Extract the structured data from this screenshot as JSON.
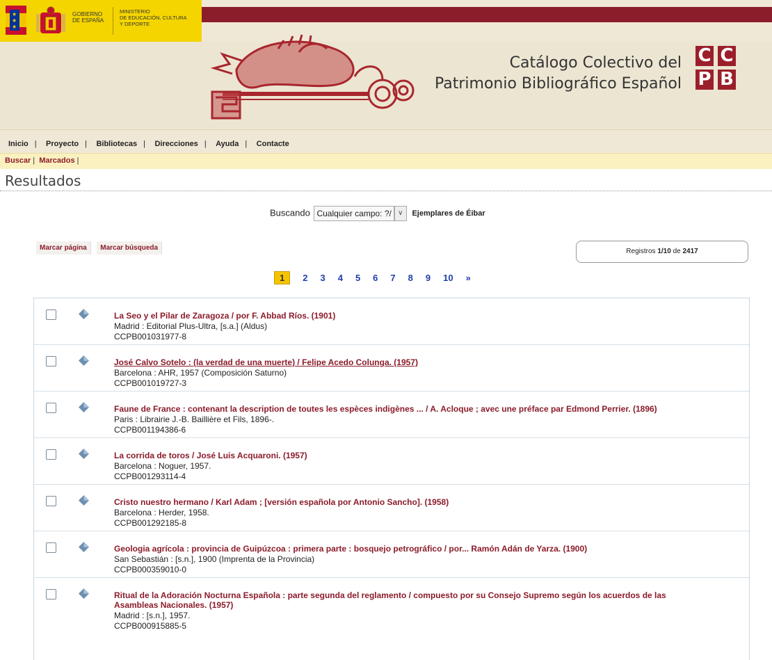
{
  "header": {
    "gobierno": "GOBIERNO\nDE ESPAÑA",
    "ministerio": "MINISTERIO\nDE EDUCACIÓN, CULTURA\nY DEPORTE",
    "catalog_title_line1": "Catálogo Colectivo del",
    "catalog_title_line2": "Patrimonio Bibliográfico Español",
    "logo_letters": [
      "C",
      "C",
      "P",
      "B"
    ]
  },
  "nav": {
    "items": [
      "Inicio",
      "Proyecto",
      "Bibliotecas",
      "Direcciones",
      "Ayuda",
      "Contacte"
    ]
  },
  "subnav": {
    "items": [
      "Buscar",
      "Marcados"
    ]
  },
  "page_title": "Resultados",
  "search": {
    "label": "Buscando",
    "field_select": "Cualquier campo: ?/",
    "scope": "Ejemplares de Éibar"
  },
  "actions": {
    "mark_page": "Marcar página",
    "mark_search": "Marcar búsqueda"
  },
  "records_box": {
    "prefix": "Registros",
    "range": "1/10",
    "of": "de",
    "total": "2417"
  },
  "pagination": {
    "current": "1",
    "pages": [
      "2",
      "3",
      "4",
      "5",
      "6",
      "7",
      "8",
      "9",
      "10"
    ],
    "next": "»"
  },
  "colors": {
    "accent": "#8b1c2a",
    "link": "#1f3fa8",
    "highlight": "#f5c400"
  },
  "results": [
    {
      "title": "La Seo y el Pilar de Zaragoza / por F. Abbad Ríos. (1901)",
      "pub": "Madrid : Editorial Plus-Ultra, [s.a.] (Aldus)",
      "id": "CCPB001031977-8"
    },
    {
      "title": "José Calvo Sotelo : (la verdad de una muerte) / Felipe Acedo Colunga. (1957)",
      "pub": "Barcelona : AHR, 1957 (Composición Saturno)",
      "id": "CCPB001019727-3"
    },
    {
      "title": "Faune de France : contenant la description de toutes les espèces indigènes ... / A. Acloque ; avec une préface par Edmond Perrier. (1896)",
      "pub": "Paris : Librairie J.-B. Baillière et Fils, 1896-.",
      "id": "CCPB001194386-6"
    },
    {
      "title": "La corrida de toros / José Luis Acquaroni. (1957)",
      "pub": "Barcelona : Noguer, 1957.",
      "id": "CCPB001293114-4"
    },
    {
      "title": "Cristo nuestro hermano / Karl Adam ; [versión española por Antonio Sancho]. (1958)",
      "pub": "Barcelona : Herder, 1958.",
      "id": "CCPB001292185-8"
    },
    {
      "title": "Geologia agrícola : provincia de Guipúzcoa : primera parte : bosquejo petrográfico / por... Ramón Adán de Yarza. (1900)",
      "pub": "San Sebastián : [s.n.], 1900 (Imprenta de la Provincia)",
      "id": "CCPB000359010-0"
    },
    {
      "title_line1": "Ritual de la Adoración Nocturna Española : parte segunda del reglamento / compuesto por su Consejo Supremo según los acuerdos de las",
      "title_line2": "Asambleas Nacionales. (1957)",
      "pub": "Madrid : [s.n.], 1957.",
      "id": "CCPB000915885-5"
    }
  ]
}
